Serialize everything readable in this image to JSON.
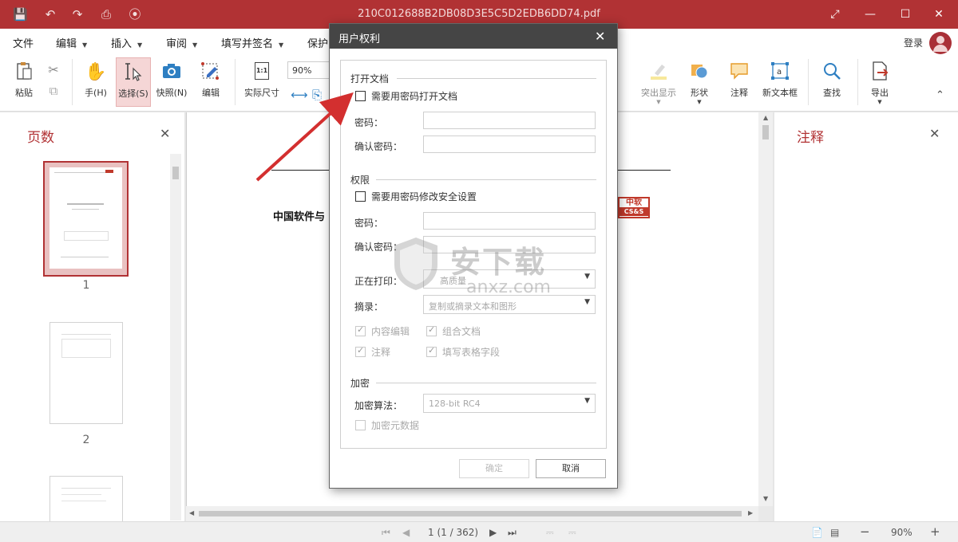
{
  "titlebar": {
    "filename": "210C012688B2DB08D3E5C5D2EDB6DD74.pdf"
  },
  "menu": {
    "items": [
      {
        "label": "文件"
      },
      {
        "label": "编辑"
      },
      {
        "label": "插入"
      },
      {
        "label": "审阅"
      },
      {
        "label": "填写并签名"
      },
      {
        "label": "保护"
      }
    ],
    "login": "登录"
  },
  "toolbar": {
    "paste": "粘贴",
    "hand": "手(H)",
    "select": "选择(S)",
    "snapshot": "快照(N)",
    "edit": "编辑",
    "actual_size": "实际尺寸",
    "actual_icon_text": "1:1",
    "zoom": "90%",
    "highlight": "突出显示",
    "shape": "形状",
    "comment": "注释",
    "textbox": "新文本框",
    "find": "查找",
    "export": "导出"
  },
  "left_panel": {
    "title": "页数",
    "pages": [
      {
        "label": "1"
      },
      {
        "label": "2"
      }
    ]
  },
  "document": {
    "heading": "中国软件与",
    "logo_top": "中软",
    "logo_bottom": "CS&S"
  },
  "right_panel": {
    "title": "注释"
  },
  "status": {
    "page_indicator": "1 (1 / 362)",
    "zoom": "90%"
  },
  "dialog": {
    "title": "用户权利",
    "open_section": "打开文档",
    "require_open_password": "需要用密码打开文档",
    "password_label": "密码：",
    "confirm_label": "确认密码：",
    "perm_section": "权限",
    "require_perm_password": "需要用密码修改安全设置",
    "printing_label": "正在打印：",
    "printing_value": "高质量",
    "extract_label": "摘录：",
    "extract_value": "复制或摘录文本和图形",
    "content_edit": "内容编辑",
    "combine_docs": "组合文档",
    "comments": "注释",
    "fill_forms": "填写表格字段",
    "encrypt_section": "加密",
    "algo_label": "加密算法：",
    "algo_value": "128-bit RC4",
    "encrypt_metadata": "加密元数据",
    "ok": "确定",
    "cancel": "取消"
  },
  "watermark": {
    "text_cn": "安下载",
    "text_en": "anxz.com"
  }
}
